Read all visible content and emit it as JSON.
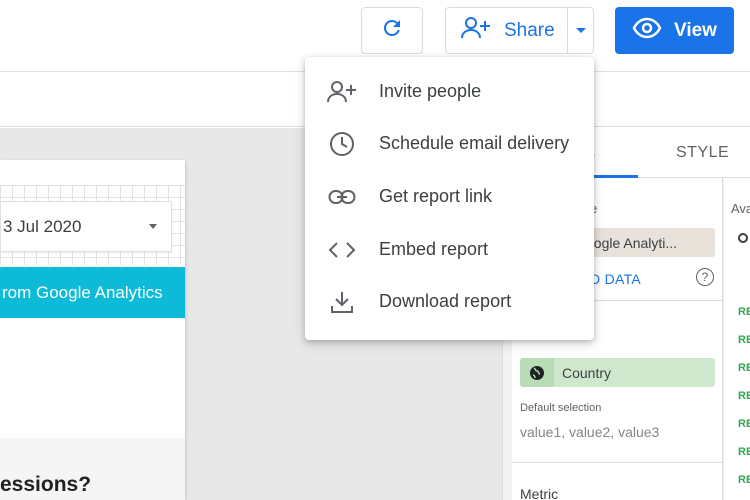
{
  "header": {
    "share_label": "Share",
    "view_label": "View"
  },
  "share_menu": {
    "items": [
      {
        "label": "Invite people",
        "icon": "person-add-icon"
      },
      {
        "label": "Schedule email delivery",
        "icon": "clock-icon"
      },
      {
        "label": "Get report link",
        "icon": "link-icon"
      },
      {
        "label": "Embed report",
        "icon": "code-icon"
      },
      {
        "label": "Download report",
        "icon": "download-icon"
      }
    ]
  },
  "canvas": {
    "date_control": "3 Jul 2020",
    "banner_text": "rom Google Analytics",
    "question_text": "essions?"
  },
  "panel": {
    "tabs": {
      "data": "A",
      "style": "STYLE"
    },
    "data_source_label": "e",
    "data_source_chip": "oogle Analyti...",
    "add_data": "D DATA",
    "help": "?",
    "dimension_chip": "Country",
    "default_selection_label": "Default selection",
    "default_selection_value": "value1, value2, value3",
    "metric_label": "Metric",
    "available_label": "Ava",
    "field_tag": "REC"
  },
  "colors": {
    "accent": "#1a73e8",
    "banner": "#0dbad8",
    "dimension_green": "#cfe8cd",
    "metric_green": "#34a853"
  }
}
